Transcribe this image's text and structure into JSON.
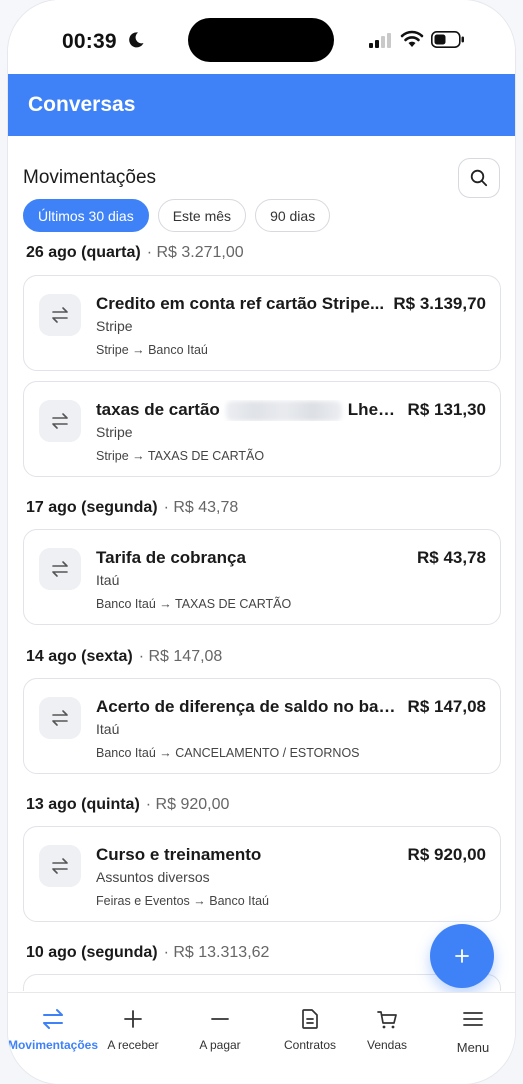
{
  "status_bar": {
    "time": "00:39",
    "icons": [
      "moon-icon",
      "signal-icon",
      "wifi-icon",
      "battery-icon"
    ]
  },
  "header": {
    "title": "Conversas"
  },
  "section": {
    "title": "Movimentações",
    "search_icon": "search-icon"
  },
  "filters": [
    {
      "label": "Últimos 30 dias",
      "active": true
    },
    {
      "label": "Este mês",
      "active": false
    },
    {
      "label": "90 dias",
      "active": false
    }
  ],
  "groups": [
    {
      "date": "26 ago (quarta)",
      "sum": "· R$ 3.271,00",
      "items": [
        {
          "title": "Credito em conta ref cartão Stripe...",
          "amount": "R$ 3.139,70",
          "sub": "Stripe",
          "route": "Stripe → Banco Itaú"
        },
        {
          "title_prefix": "taxas de cartão",
          "title_suffix": "Lhe ...",
          "amount": "R$ 131,30",
          "sub": "Stripe",
          "route": "Stripe → TAXAS DE CARTÃO"
        }
      ]
    },
    {
      "date": "17 ago (segunda)",
      "sum": "· R$ 43,78",
      "items": [
        {
          "title": "Tarifa de cobrança",
          "amount": "R$ 43,78",
          "sub": "Itaú",
          "route": "Banco Itaú → TAXAS DE CARTÃO"
        }
      ]
    },
    {
      "date": "14 ago (sexta)",
      "sum": "· R$ 147,08",
      "items": [
        {
          "title": "Acerto de diferença de saldo no ban...",
          "amount": "R$ 147,08",
          "sub": "Itaú",
          "route": "Banco Itaú → CANCELAMENTO / ESTORNOS"
        }
      ]
    },
    {
      "date": "13 ago (quinta)",
      "sum": "· R$ 920,00",
      "items": [
        {
          "title": "Curso e treinamento",
          "amount": "R$ 920,00",
          "sub": "Assuntos diversos",
          "route": "Feiras e Eventos → Banco Itaú"
        }
      ]
    },
    {
      "date": "10 ago (segunda)",
      "sum": "· R$ 13.313,62",
      "items": []
    }
  ],
  "fab": {
    "icon": "plus-icon"
  },
  "bottom_nav": [
    {
      "label": "Movimentações",
      "icon": "transfer-arrows-icon",
      "active": true
    },
    {
      "label": "A receber",
      "icon": "plus-icon",
      "active": false
    },
    {
      "label": "A pagar",
      "icon": "minus-icon",
      "active": false
    },
    {
      "label": "Contratos",
      "icon": "document-icon",
      "active": false
    },
    {
      "label": "Vendas",
      "icon": "cart-icon",
      "active": false
    },
    {
      "label": "Menu",
      "icon": "hamburger-menu-icon",
      "active": false
    }
  ],
  "colors": {
    "accent": "#3f82f7",
    "text": "#1a1a1a",
    "muted": "#666666"
  }
}
